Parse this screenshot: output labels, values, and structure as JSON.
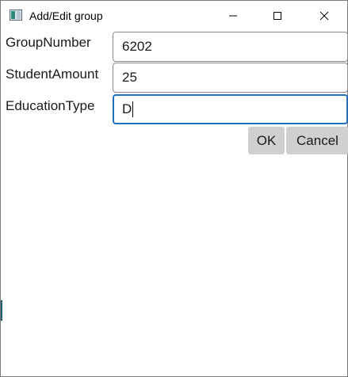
{
  "window": {
    "title": "Add/Edit group",
    "controls": {
      "minimize_icon": "minimize-icon",
      "maximize_icon": "maximize-icon",
      "close_icon": "close-icon"
    }
  },
  "form": {
    "fields": [
      {
        "label": "GroupNumber",
        "value": "6202"
      },
      {
        "label": "StudentAmount",
        "value": "25"
      },
      {
        "label": "EducationType",
        "value": "D"
      }
    ],
    "focused_field": "EducationType"
  },
  "actions": {
    "ok_label": "OK",
    "cancel_label": "Cancel"
  },
  "colors": {
    "focus_border": "#1f72c5",
    "button_bg": "#d0d0d0"
  }
}
